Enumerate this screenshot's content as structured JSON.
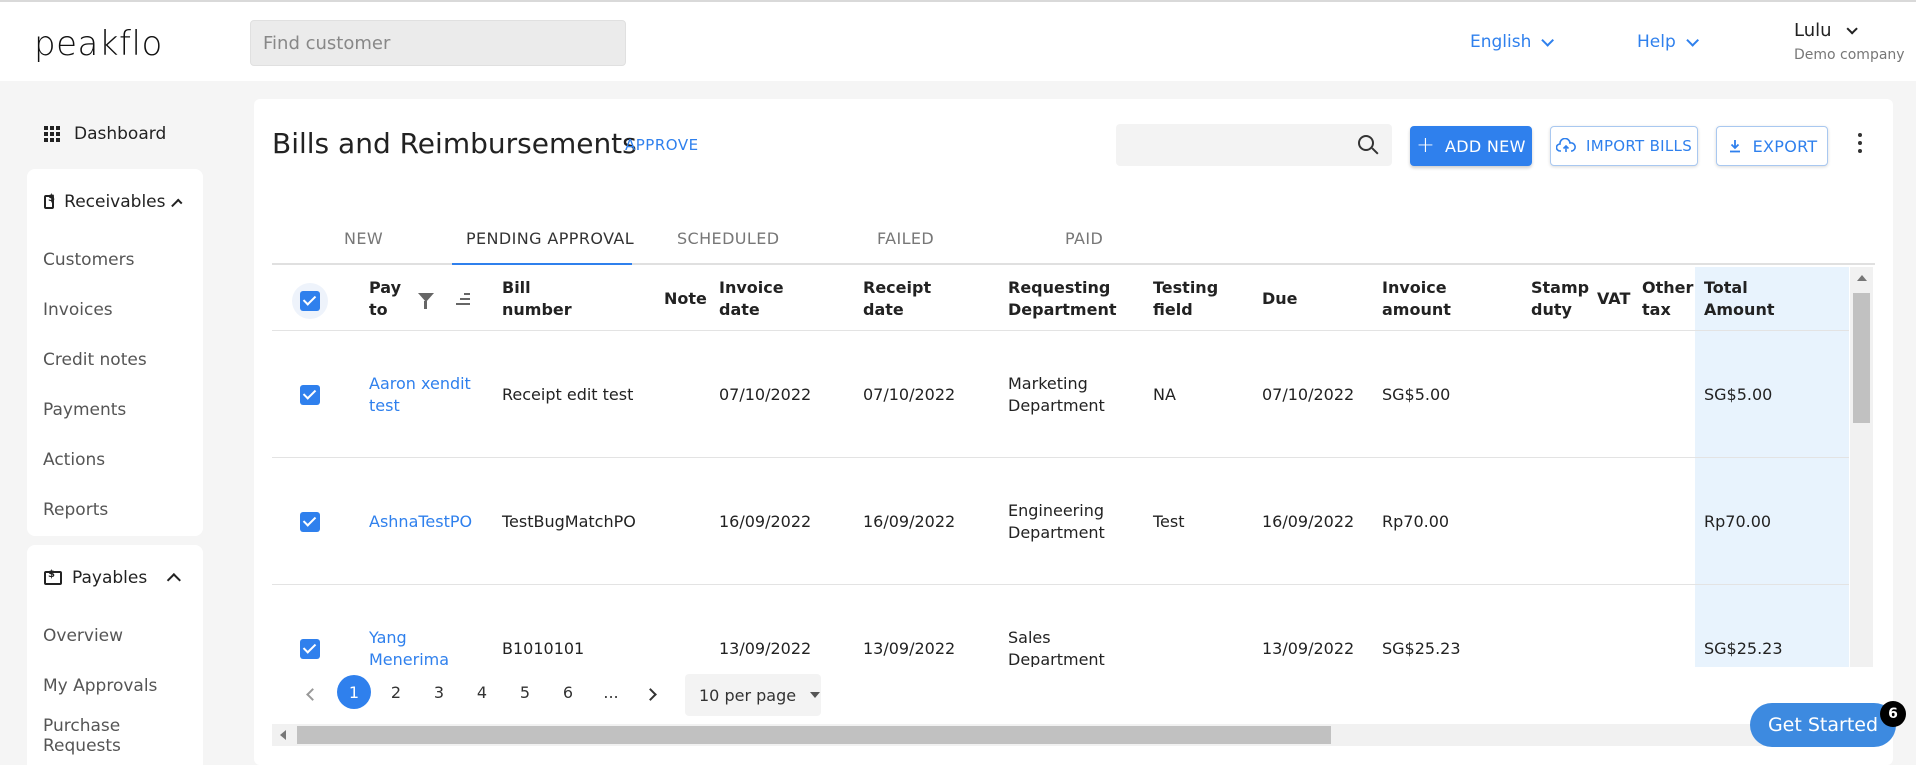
{
  "brand": {
    "logo_text": "peakflo"
  },
  "header": {
    "search_placeholder": "Find customer",
    "language_label": "English",
    "help_label": "Help",
    "user_name": "Lulu",
    "user_company": "Demo company"
  },
  "sidebar": {
    "dashboard_label": "Dashboard",
    "receivables": {
      "title": "Receivables",
      "items": [
        "Customers",
        "Invoices",
        "Credit notes",
        "Payments",
        "Actions",
        "Reports"
      ]
    },
    "payables": {
      "title": "Payables",
      "items": [
        "Overview",
        "My Approvals",
        "Purchase Requests"
      ]
    }
  },
  "page": {
    "title": "Bills and Reimbursements",
    "approve_label": "APPROVE",
    "add_new_label": "ADD NEW",
    "import_label": "IMPORT BILLS",
    "export_label": "EXPORT"
  },
  "tabs": [
    "NEW",
    "PENDING APPROVAL",
    "SCHEDULED",
    "FAILED",
    "PAID"
  ],
  "active_tab": "PENDING APPROVAL",
  "table": {
    "headers": {
      "pay_to": "Pay to",
      "bill_number": "Bill number",
      "note": "Note",
      "invoice_date": "Invoice date",
      "receipt_date": "Receipt date",
      "requesting_department": "Requesting Department",
      "testing_field": "Testing field",
      "due": "Due",
      "invoice_amount": "Invoice amount",
      "stamp_duty": "Stamp duty",
      "vat": "VAT",
      "other_tax": "Other tax",
      "total_amount": "Total Amount"
    },
    "rows": [
      {
        "pay_to": "Aaron xendit test",
        "bill_number": "Receipt edit test",
        "note": "",
        "invoice_date": "07/10/2022",
        "receipt_date": "07/10/2022",
        "requesting_department": "Marketing Department",
        "testing_field": "NA",
        "due": "07/10/2022",
        "invoice_amount": "SG$5.00",
        "stamp_duty": "",
        "vat": "",
        "other_tax": "",
        "total_amount": "SG$5.00"
      },
      {
        "pay_to": "AshnaTestPO",
        "bill_number": "TestBugMatchPO",
        "note": "",
        "invoice_date": "16/09/2022",
        "receipt_date": "16/09/2022",
        "requesting_department": "Engineering Department",
        "testing_field": "Test",
        "due": "16/09/2022",
        "invoice_amount": "Rp70.00",
        "stamp_duty": "",
        "vat": "",
        "other_tax": "",
        "total_amount": "Rp70.00"
      },
      {
        "pay_to": "Yang Menerima",
        "bill_number": "B1010101",
        "note": "",
        "invoice_date": "13/09/2022",
        "receipt_date": "13/09/2022",
        "requesting_department": "Sales Department",
        "testing_field": "",
        "due": "13/09/2022",
        "invoice_amount": "SG$25.23",
        "stamp_duty": "",
        "vat": "",
        "other_tax": "",
        "total_amount": "SG$25.23"
      }
    ]
  },
  "pagination": {
    "pages": [
      "1",
      "2",
      "3",
      "4",
      "5",
      "6",
      "..."
    ],
    "current": "1",
    "per_page_label": "10 per page"
  },
  "onboarding": {
    "label": "Get Started",
    "badge": "6"
  },
  "colors": {
    "accent": "#2f80ed",
    "total_column_bg": "#e8f3fd"
  }
}
